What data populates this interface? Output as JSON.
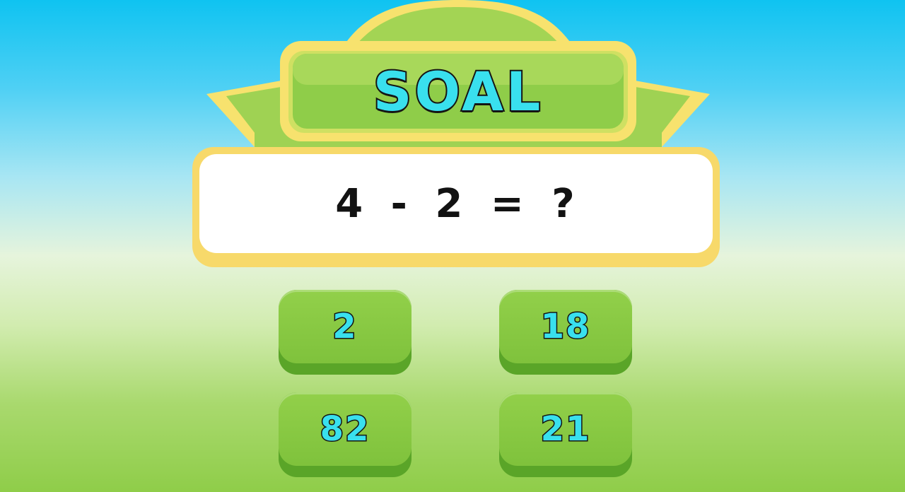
{
  "game": {
    "title": "SOAL",
    "question": "4 - 2 = ?",
    "answers": [
      "2",
      "18",
      "82",
      "21"
    ]
  },
  "colors": {
    "sky_top": "#0fc3f1",
    "grass_bottom": "#8fcd49",
    "banner_green": "#8fcd49",
    "banner_border": "#f7e26e",
    "title_fill": "#39e0ee",
    "button_green": "#87c841",
    "answer_text": "#39e0ee"
  }
}
